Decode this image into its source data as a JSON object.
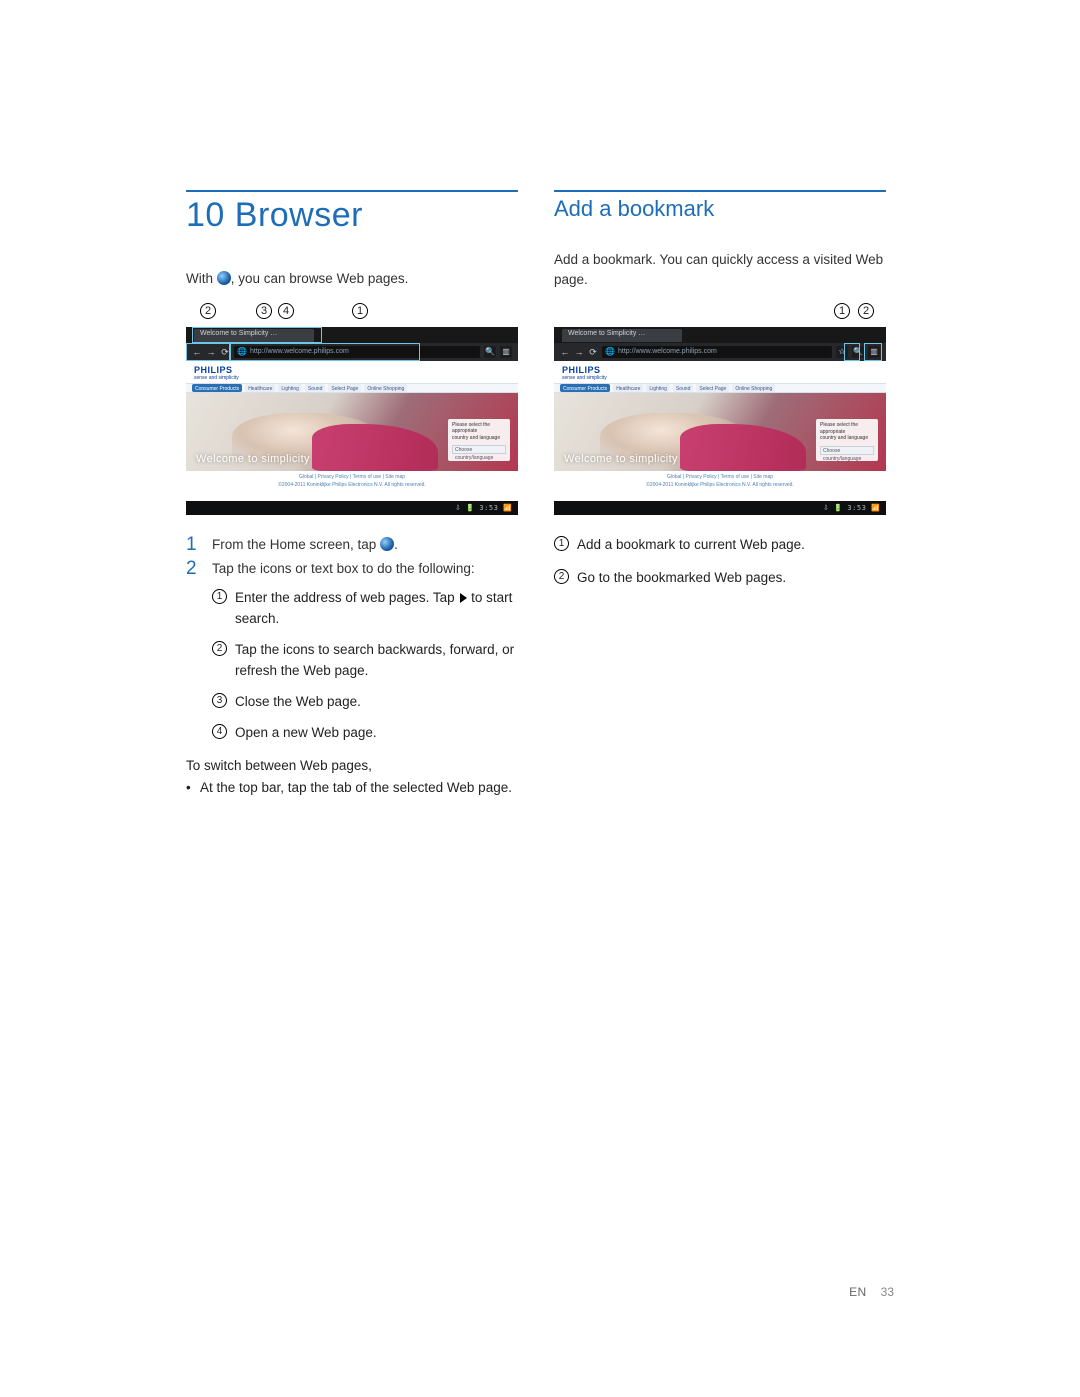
{
  "left": {
    "title": "10 Browser",
    "intro_before": "With ",
    "intro_after": ", you can browse Web pages.",
    "callouts_top": [
      "2",
      "3",
      "4",
      "1"
    ],
    "shot": {
      "tab_label": "Welcome to Simplicity …",
      "url": "http://www.welcome.philips.com",
      "logo": "PHILIPS",
      "sublogo": "sense and simplicity",
      "topnav": [
        "Consumer Products",
        "Healthcare",
        "Lighting",
        "Sound",
        "Select Page",
        "Online Shopping"
      ],
      "hero_text": "Welcome to simplicity",
      "herobox_line1": "Please select the appropriate",
      "herobox_line2": "country and language",
      "herobox_select": "Choose country/language",
      "footer_links": "Global | Privacy Policy | Terms of use | Site map",
      "footer_copy": "©2004-2011 Koninklijke Philips Electronics N.V. All rights reserved.",
      "clock": "3:53"
    },
    "steps": [
      {
        "num": "1",
        "text_before": "From the Home screen, tap ",
        "text_after": "."
      },
      {
        "num": "2",
        "text": "Tap the icons or text box to do the following:"
      }
    ],
    "substeps": [
      {
        "n": "1",
        "text": "Enter the address of web pages. Tap ",
        "has_tri": true,
        "text2": " to start search."
      },
      {
        "n": "2",
        "text": "Tap the icons to search backwards, forward, or refresh the Web page."
      },
      {
        "n": "3",
        "text": "Close the Web page."
      },
      {
        "n": "4",
        "text": "Open a new Web page."
      }
    ],
    "switch_heading": "To switch between Web pages,",
    "switch_bullet": "At the top bar, tap the tab of the selected Web page."
  },
  "right": {
    "title": "Add a bookmark",
    "intro": "Add a bookmark. You can quickly access a visited Web page.",
    "callouts_top": [
      "1",
      "2"
    ],
    "list": [
      {
        "n": "1",
        "text": "Add a bookmark to current Web page."
      },
      {
        "n": "2",
        "text": "Go to the bookmarked Web pages."
      }
    ]
  },
  "footer": {
    "lang": "EN",
    "page": "33"
  }
}
